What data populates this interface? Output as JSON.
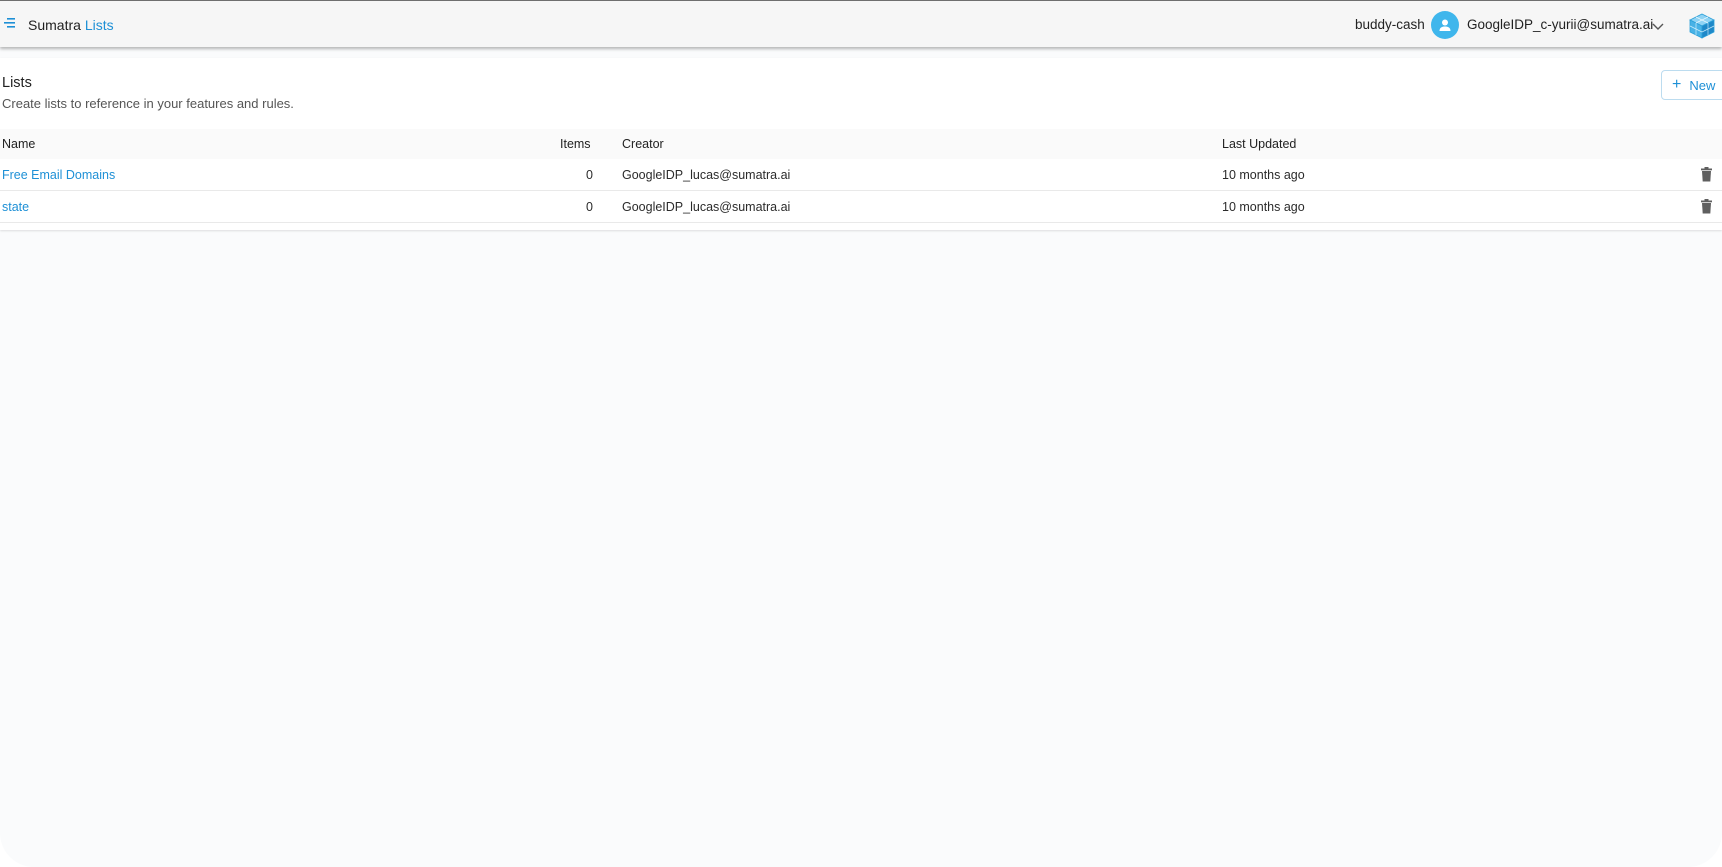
{
  "header": {
    "brand": "Sumatra",
    "section": "Lists",
    "org": "buddy-cash",
    "user": "GoogleIDP_c-yurii@sumatra.ai"
  },
  "page": {
    "title": "Lists",
    "subtitle": "Create lists to reference in your features and rules.",
    "new_label": "New"
  },
  "table": {
    "columns": [
      "Name",
      "Items",
      "Creator",
      "Last Updated"
    ],
    "rows": [
      {
        "name": "Free Email Domains",
        "items": "0",
        "creator": "GoogleIDP_lucas@sumatra.ai",
        "updated": "10 months ago"
      },
      {
        "name": "state",
        "items": "0",
        "creator": "GoogleIDP_lucas@sumatra.ai",
        "updated": "10 months ago"
      }
    ]
  },
  "icons": {
    "menu": "menu-icon",
    "avatar": "user-icon",
    "dropdown": "chevron-down-icon",
    "logo": "cube-logo-icon",
    "add": "plus-icon",
    "delete": "trash-icon"
  },
  "colors": {
    "accent": "#1e90d6",
    "avatar": "#3fb6ec",
    "icon_gray": "#5f5f5f"
  }
}
